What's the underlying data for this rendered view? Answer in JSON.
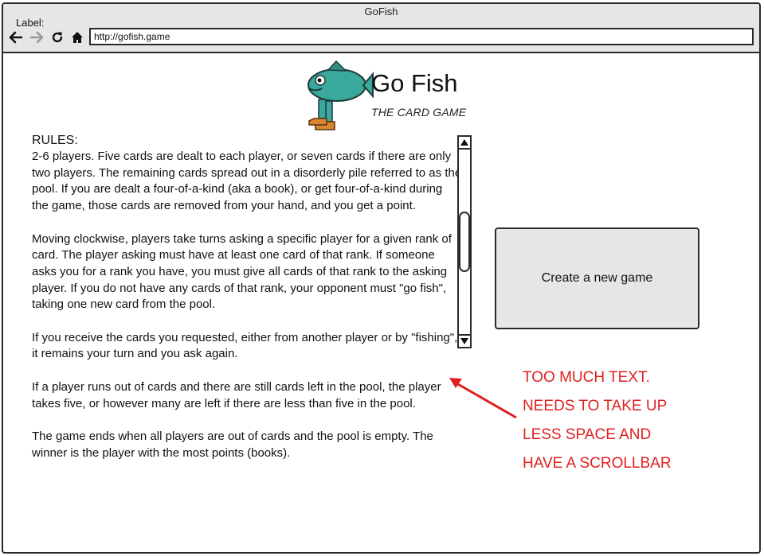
{
  "window": {
    "title": "GoFish"
  },
  "browser": {
    "label": "Label:",
    "url": "http://gofish.game",
    "icons": [
      "back-arrow-icon",
      "forward-arrow-icon",
      "reload-icon",
      "home-icon"
    ]
  },
  "header": {
    "title": "Go Fish",
    "subtitle": "THE CARD GAME"
  },
  "rules": {
    "heading": "RULES:",
    "paragraphs": [
      "2-6 players. Five cards are dealt to each player, or seven cards if there are only two players. The remaining cards spread out in a disorderly pile referred to as the pool. If you are dealt a four-of-a-kind (aka a book), or get four-of-a-kind during the game, those cards are removed from your hand, and you get a point.",
      "Moving clockwise, players take turns asking a specific player for a given rank of card. The player asking must have at least one card of that rank. If someone asks you for a rank you have, you must give all cards of that rank to the asking player. If you do not have any cards of that rank, your opponent must \"go fish\", taking one new card from the pool.",
      "If you receive the cards you requested, either from another player or by \"fishing\", it remains your turn and you ask again.",
      "If a player runs out of cards and there are still cards left in the pool, the player takes five, or however many are left if there are less than five in the pool.",
      "The game ends when all players are out of cards and the pool is empty. The winner is the player with the most points (books)."
    ]
  },
  "actions": {
    "create_game": "Create a new game"
  },
  "annotation": {
    "lines": [
      "TOO MUCH TEXT.",
      "NEEDS TO TAKE UP",
      "LESS SPACE AND",
      "HAVE A SCROLLBAR"
    ],
    "color": "#e02020"
  },
  "colors": {
    "chrome": "#e6e6e6",
    "border": "#2a2a2a",
    "fish": "#3aa89a"
  }
}
